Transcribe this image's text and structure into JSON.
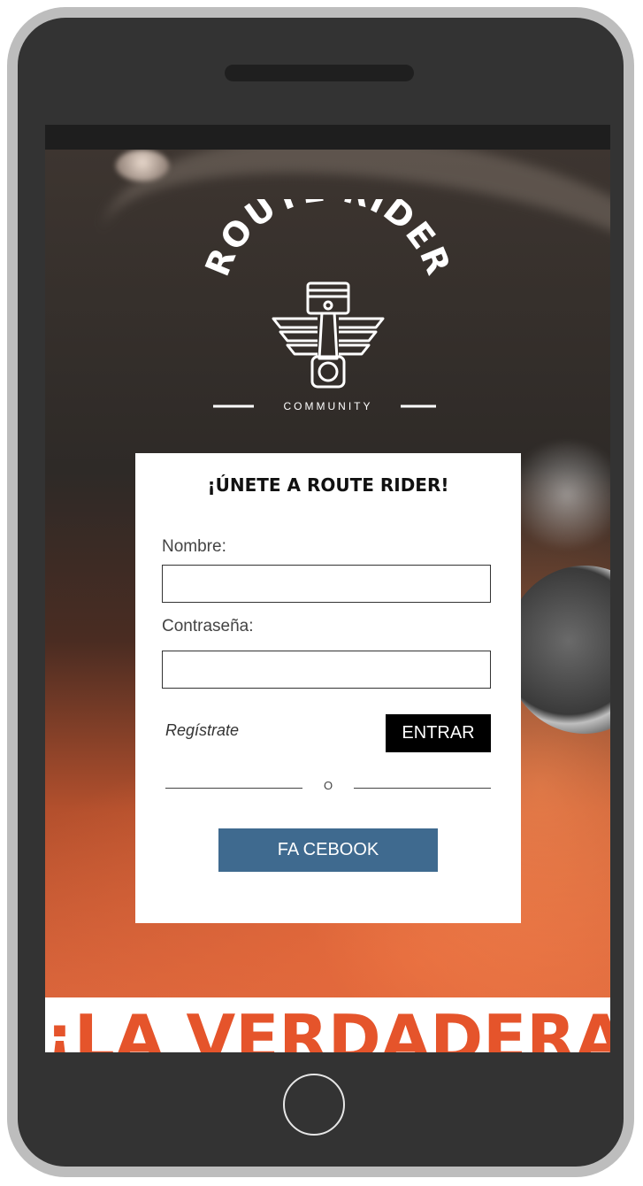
{
  "logo": {
    "title": "ROUTE RIDER",
    "subtitle": "COMMUNITY",
    "icon": "piston-wings-icon"
  },
  "signup_card": {
    "heading": "¡ÚNETE A ROUTE RIDER!",
    "name_label": "Nombre:",
    "name_value": "",
    "password_label": "Contraseña:",
    "password_value": "",
    "register_link": "Regístrate",
    "enter_button": "ENTRAR",
    "divider_text": "O",
    "facebook_button": "FA CEBOOK"
  },
  "headline": "¡LA VERDADERA",
  "colors": {
    "accent": "#e5542b",
    "facebook": "#3f6a8f",
    "enter_button": "#000000"
  }
}
